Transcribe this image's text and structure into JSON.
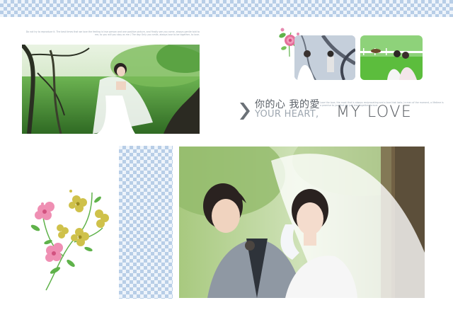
{
  "texts": {
    "top_fine_print": "Do not try to reproduce it. The best times that we love the feeling is true person and one positive picture, and finally see you come, always gentle told to me, to you will you stay as me / The day Only you smile, always love to be together, to love.",
    "right_fine_print": "Love the love, the most that is always reciprocating and a love that lasts / a man of the moment, a lifetime is a promise to you that we just stay together forever.",
    "title_cn": "你的心 我的愛",
    "title_en_small": "YOUR HEART,",
    "title_en_large": "MY LOVE"
  },
  "colors": {
    "accent_gray": "#5b6168",
    "check_blue": "#8cafd7",
    "leaf_green": "#5fb24a",
    "petal_pink": "#e56f9a",
    "petal_yellow": "#c9b83a"
  }
}
